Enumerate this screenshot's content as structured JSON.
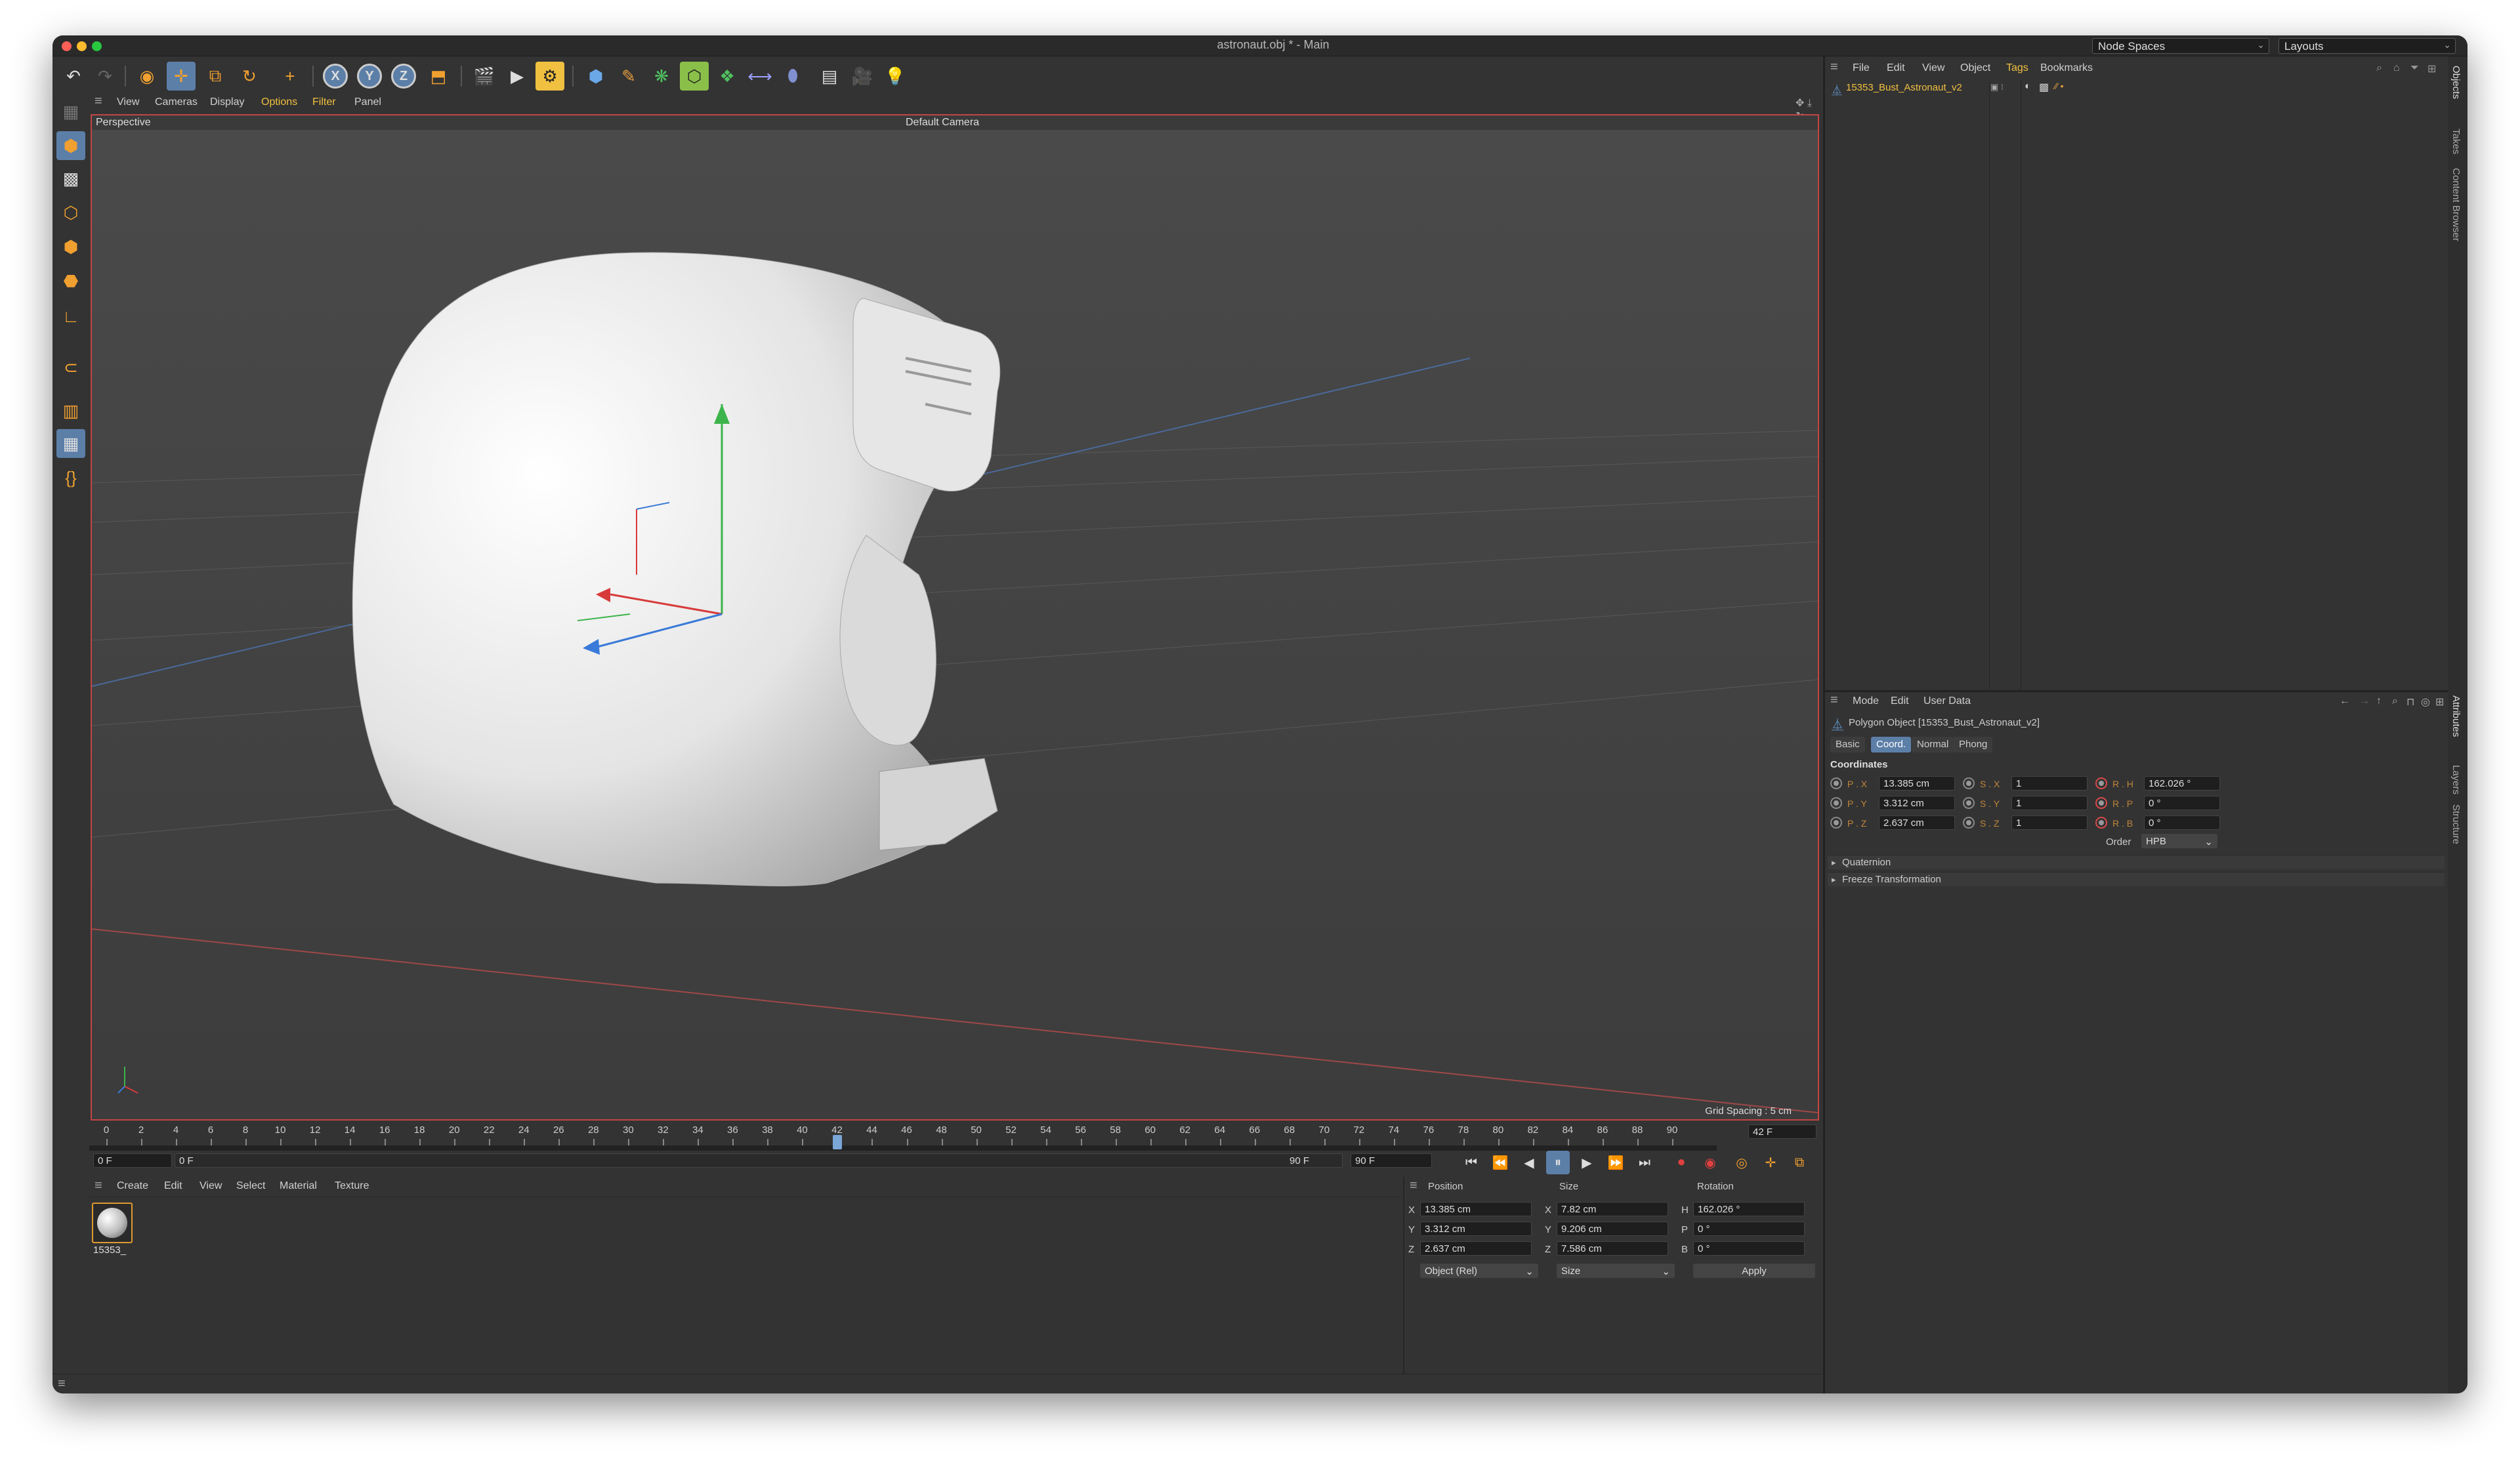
{
  "window": {
    "title": "astronaut.obj * - Main",
    "node_spaces": "Node Spaces",
    "layouts": "Layouts"
  },
  "viewport": {
    "menu": [
      "View",
      "Cameras",
      "Display",
      "Options",
      "Filter",
      "Panel"
    ],
    "view_name": "Perspective",
    "camera": "Default Camera",
    "grid_spacing": "Grid Spacing : 5 cm"
  },
  "timeline": {
    "ticks": [
      "0",
      "2",
      "4",
      "6",
      "8",
      "10",
      "12",
      "14",
      "16",
      "18",
      "20",
      "22",
      "24",
      "26",
      "28",
      "30",
      "32",
      "34",
      "36",
      "38",
      "40",
      "42",
      "44",
      "46",
      "48",
      "50",
      "52",
      "54",
      "56",
      "58",
      "60",
      "62",
      "64",
      "66",
      "68",
      "70",
      "72",
      "74",
      "76",
      "78",
      "80",
      "82",
      "84",
      "86",
      "88",
      "90"
    ],
    "current_frame": "42 F",
    "start_field": "0 F",
    "start_field2": "0 F",
    "end_field": "90 F",
    "end_field2": "90 F",
    "playhead_fraction": 0.4667
  },
  "material": {
    "menu": [
      "Create",
      "Edit",
      "View",
      "Select",
      "Material",
      "Texture"
    ],
    "swatch_label": "15353_"
  },
  "coord_manager": {
    "headers": {
      "position": "Position",
      "size": "Size",
      "rotation": "Rotation"
    },
    "rows": [
      {
        "axis": "X",
        "pos": "13.385 cm",
        "saxis": "X",
        "size": "7.82 cm",
        "raxis": "H",
        "rot": "162.026 °"
      },
      {
        "axis": "Y",
        "pos": "3.312 cm",
        "saxis": "Y",
        "size": "9.206 cm",
        "raxis": "P",
        "rot": "0 °"
      },
      {
        "axis": "Z",
        "pos": "2.637 cm",
        "saxis": "Z",
        "size": "7.586 cm",
        "raxis": "B",
        "rot": "0 °"
      }
    ],
    "mode_select": "Object (Rel)",
    "size_select": "Size",
    "apply": "Apply"
  },
  "object_manager": {
    "menu": [
      "File",
      "Edit",
      "View",
      "Object",
      "Tags",
      "Bookmarks"
    ],
    "object_name": "15353_Bust_Astronaut_v2"
  },
  "attributes": {
    "menu": [
      "Mode",
      "Edit",
      "User Data"
    ],
    "title": "Polygon Object [15353_Bust_Astronaut_v2]",
    "tabs": [
      "Basic",
      "Coord.",
      "Normal",
      "Phong"
    ],
    "section": "Coordinates",
    "rows": [
      {
        "p": "P . X",
        "pv": "13.385 cm",
        "s": "S . X",
        "sv": "1",
        "r": "R . H",
        "rv": "162.026 °"
      },
      {
        "p": "P . Y",
        "pv": "3.312 cm",
        "s": "S . Y",
        "sv": "1",
        "r": "R . P",
        "rv": "0 °"
      },
      {
        "p": "P . Z",
        "pv": "2.637 cm",
        "s": "S . Z",
        "sv": "1",
        "r": "R . B",
        "rv": "0 °"
      }
    ],
    "order_label": "Order",
    "order_value": "HPB",
    "quaternion": "Quaternion",
    "freeze": "Freeze Transformation"
  },
  "side_tabs": [
    "Objects",
    "Takes",
    "Content Browser",
    "Attributes",
    "Layers",
    "Structure"
  ],
  "colors": {
    "accent": "#5c7fa8",
    "highlight": "#f0c040",
    "viewport_border": "#c24545"
  }
}
